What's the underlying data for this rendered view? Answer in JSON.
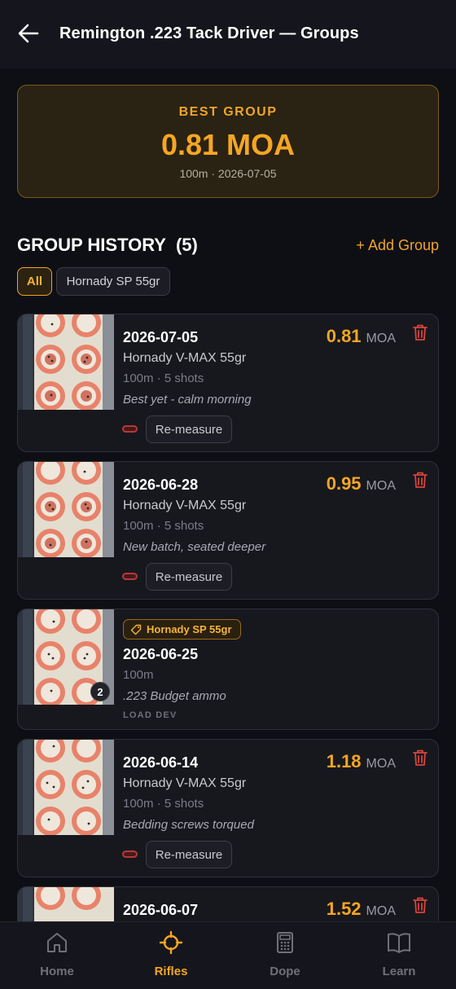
{
  "header": {
    "title": "Remington .223 Tack Driver — Groups"
  },
  "best": {
    "label": "BEST GROUP",
    "value": "0.81 MOA",
    "meta": "100m · 2026-07-05"
  },
  "history": {
    "title": "GROUP HISTORY",
    "count": "(5)",
    "add_label": "+ Add Group"
  },
  "filters": [
    {
      "label": "All",
      "selected": true
    },
    {
      "label": "Hornady SP 55gr",
      "selected": false
    }
  ],
  "groups": [
    {
      "date": "2026-07-05",
      "moa_value": "0.81",
      "moa_unit": "MOA",
      "ammo": "Hornady V-MAX 55gr",
      "meta": "100m · 5 shots",
      "note": "Best yet - calm morning",
      "action": "Re-measure"
    },
    {
      "date": "2026-06-28",
      "moa_value": "0.95",
      "moa_unit": "MOA",
      "ammo": "Hornady V-MAX 55gr",
      "meta": "100m · 5 shots",
      "note": "New batch, seated deeper",
      "action": "Re-measure"
    },
    {
      "date": "2026-06-25",
      "tag": "Hornady SP 55gr",
      "meta": "100m",
      "note": ".223 Budget ammo",
      "photo_count": "2",
      "badge": "LOAD DEV"
    },
    {
      "date": "2026-06-14",
      "moa_value": "1.18",
      "moa_unit": "MOA",
      "ammo": "Hornady V-MAX 55gr",
      "meta": "100m · 5 shots",
      "note": "Bedding screws torqued",
      "action": "Re-measure"
    },
    {
      "date": "2026-06-07",
      "moa_value": "1.52",
      "moa_unit": "MOA"
    }
  ],
  "nav": [
    {
      "label": "Home",
      "icon": "home-icon",
      "active": false
    },
    {
      "label": "Rifles",
      "icon": "crosshair-icon",
      "active": true
    },
    {
      "label": "Dope",
      "icon": "calculator-icon",
      "active": false
    },
    {
      "label": "Learn",
      "icon": "book-icon",
      "active": false
    }
  ],
  "colors": {
    "accent": "#f5a623",
    "background": "#0e0f14",
    "card": "#17181e",
    "danger": "#d9443c"
  }
}
